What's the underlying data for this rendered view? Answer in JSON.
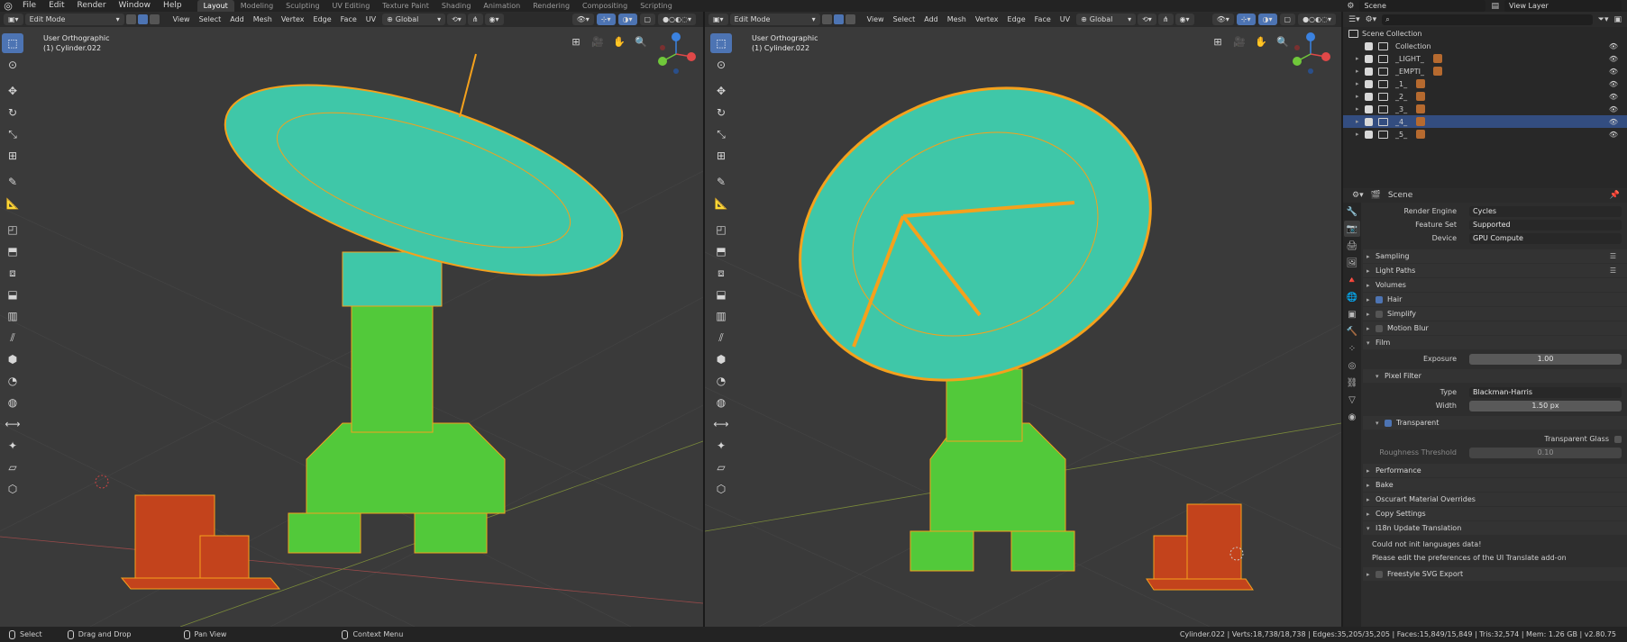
{
  "topbar": {
    "menus": [
      "File",
      "Edit",
      "Render",
      "Window",
      "Help"
    ],
    "workspaces": [
      "Layout",
      "Modeling",
      "Sculpting",
      "UV Editing",
      "Texture Paint",
      "Shading",
      "Animation",
      "Rendering",
      "Compositing",
      "Scripting"
    ],
    "active_workspace": "Layout",
    "scene_name": "Scene",
    "view_layer": "View Layer"
  },
  "viewport_left": {
    "mode": "Edit Mode",
    "menus": [
      "View",
      "Select",
      "Add",
      "Mesh",
      "Vertex",
      "Edge",
      "Face",
      "UV"
    ],
    "transform_orientation": "Global",
    "view_name": "User Orthographic",
    "object_name": "(1) Cylinder.022"
  },
  "viewport_right": {
    "mode": "Edit Mode",
    "menus": [
      "View",
      "Select",
      "Add",
      "Mesh",
      "Vertex",
      "Edge",
      "Face",
      "UV"
    ],
    "transform_orientation": "Global",
    "view_name": "User Orthographic",
    "object_name": "(1) Cylinder.022"
  },
  "outliner": {
    "root": "Scene Collection",
    "rows": [
      {
        "label": "Collection",
        "level": 1,
        "selected": false
      },
      {
        "label": "_LIGHT_",
        "level": 1,
        "selected": false
      },
      {
        "label": "_EMPTI_",
        "level": 1,
        "selected": false
      },
      {
        "label": "_1_",
        "level": 1,
        "selected": false
      },
      {
        "label": "_2_",
        "level": 1,
        "selected": false
      },
      {
        "label": "_3_",
        "level": 1,
        "selected": false
      },
      {
        "label": "_4_",
        "level": 1,
        "selected": true
      },
      {
        "label": "_5_",
        "level": 1,
        "selected": false
      }
    ]
  },
  "properties": {
    "context": "Scene",
    "render_engine": {
      "label": "Render Engine",
      "value": "Cycles"
    },
    "feature_set": {
      "label": "Feature Set",
      "value": "Supported"
    },
    "device": {
      "label": "Device",
      "value": "GPU Compute"
    },
    "panels_top": [
      {
        "label": "Sampling",
        "checkbox": null,
        "list": true
      },
      {
        "label": "Light Paths",
        "checkbox": null,
        "list": true
      },
      {
        "label": "Volumes",
        "checkbox": null,
        "list": false
      },
      {
        "label": "Hair",
        "checkbox": true,
        "list": false
      },
      {
        "label": "Simplify",
        "checkbox": false,
        "list": false
      },
      {
        "label": "Motion Blur",
        "checkbox": false,
        "list": false
      }
    ],
    "film": {
      "label": "Film",
      "exposure": {
        "label": "Exposure",
        "value": "1.00"
      },
      "pixel_filter": "Pixel Filter",
      "type": {
        "label": "Type",
        "value": "Blackman-Harris"
      },
      "width": {
        "label": "Width",
        "value": "1.50 px"
      },
      "transparent": "Transparent",
      "transparent_glass": "Transparent Glass",
      "roughness_threshold": {
        "label": "Roughness Threshold",
        "value": "0.10"
      }
    },
    "panels_bottom": [
      {
        "label": "Performance"
      },
      {
        "label": "Bake"
      },
      {
        "label": "Oscurart Material Overrides"
      },
      {
        "label": "Copy Settings"
      }
    ],
    "i18n": {
      "label": "I18n Update Translation",
      "msg1": "Could not init languages data!",
      "msg2": "Please edit the preferences of the UI Translate add-on"
    },
    "freestyle": "Freestyle SVG Export"
  },
  "statusbar": {
    "select": "Select",
    "drag": "Drag and Drop",
    "pan": "Pan View",
    "context": "Context Menu",
    "stats": "Cylinder.022 | Verts:18,738/18,738 | Edges:35,205/35,205 | Faces:15,849/15,849 | Tris:32,574 | Mem: 1.26 GB | v2.80.75"
  },
  "colors": {
    "accent": "#4d74b3",
    "selected_row": "#334d80",
    "mesh_green": "#52c93a",
    "mesh_teal": "#3fc7a8",
    "wire_orange": "#f5a11c",
    "box_red": "#c3431c"
  }
}
